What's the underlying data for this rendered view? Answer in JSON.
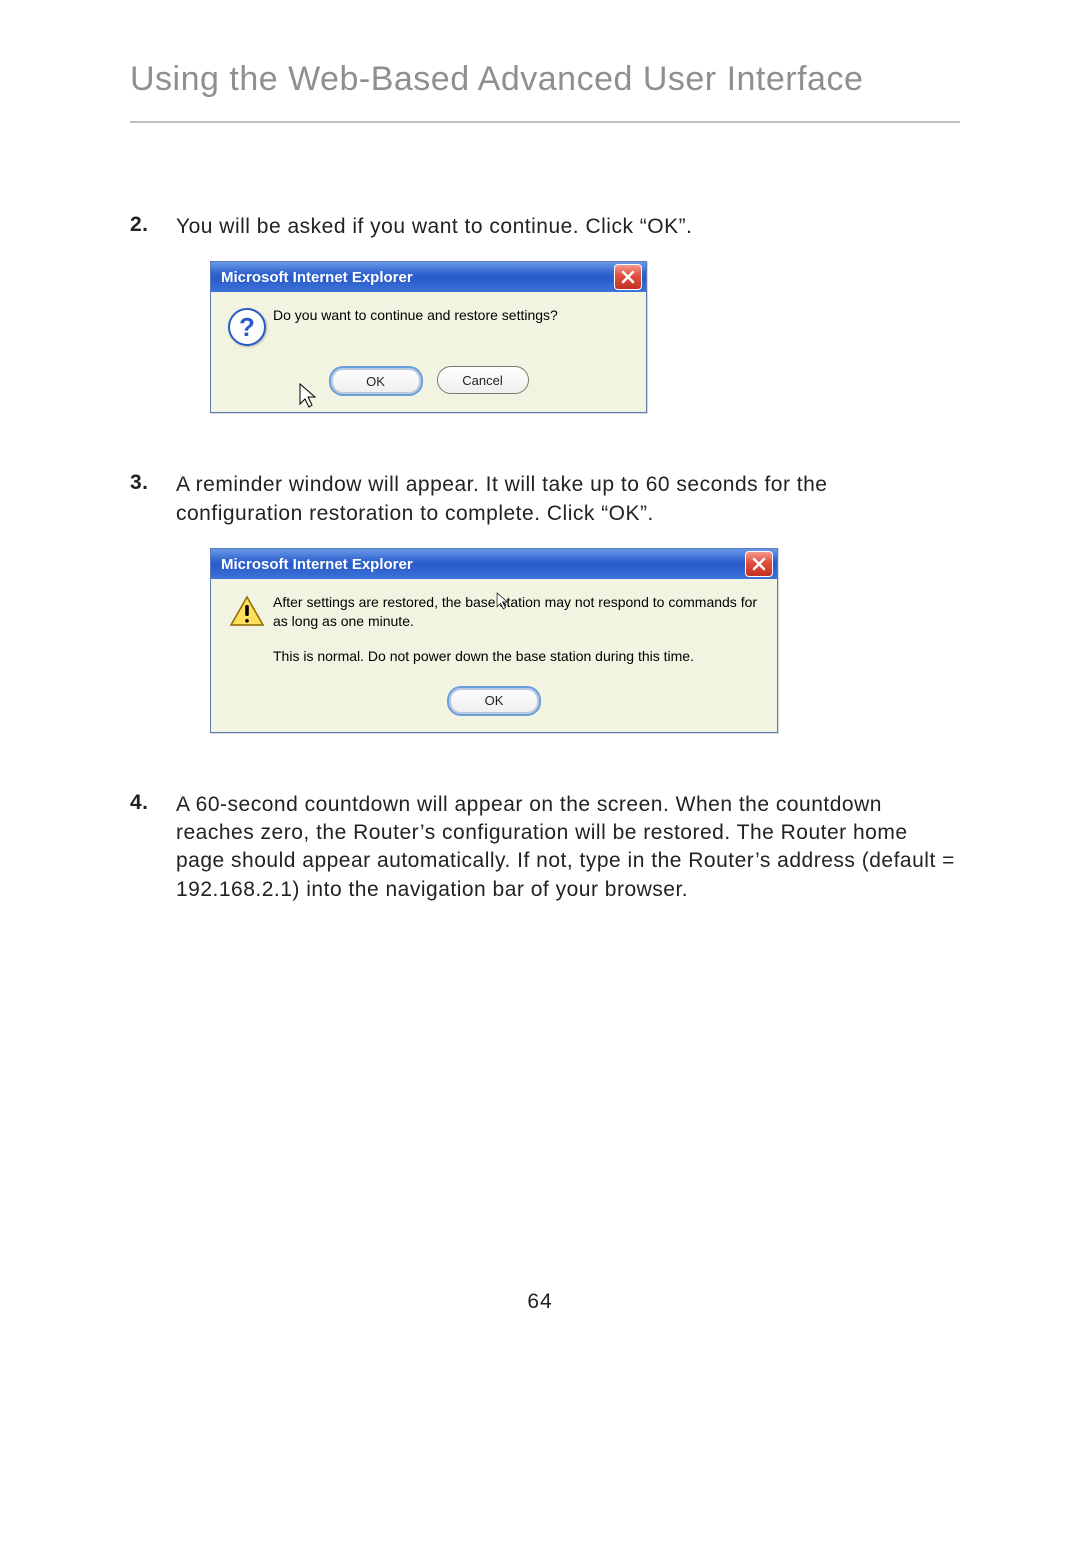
{
  "title": "Using the Web-Based Advanced User Interface",
  "steps": [
    {
      "num": "2.",
      "text": "You will be asked if you want to continue. Click “OK”."
    },
    {
      "num": "3.",
      "text": "A reminder window will appear. It will take up to 60 seconds for the configuration restoration to complete. Click “OK”."
    },
    {
      "num": "4.",
      "text": "A 60-second countdown will appear on the screen. When the countdown reaches zero, the Router’s configuration will be restored. The Router home page should appear automatically. If not, type in the Router’s address (default = 192.168.2.1) into the navigation bar of your browser."
    }
  ],
  "dialog1": {
    "title": "Microsoft Internet Explorer",
    "message": "Do you want to continue and restore settings?",
    "ok": "OK",
    "cancel": "Cancel"
  },
  "dialog2": {
    "title": "Microsoft Internet Explorer",
    "message1": "After settings are restored, the base station may not respond to commands for as long as one minute.",
    "message2": "This is normal. Do not power down the base station during this time.",
    "ok": "OK"
  },
  "page_number": "64"
}
